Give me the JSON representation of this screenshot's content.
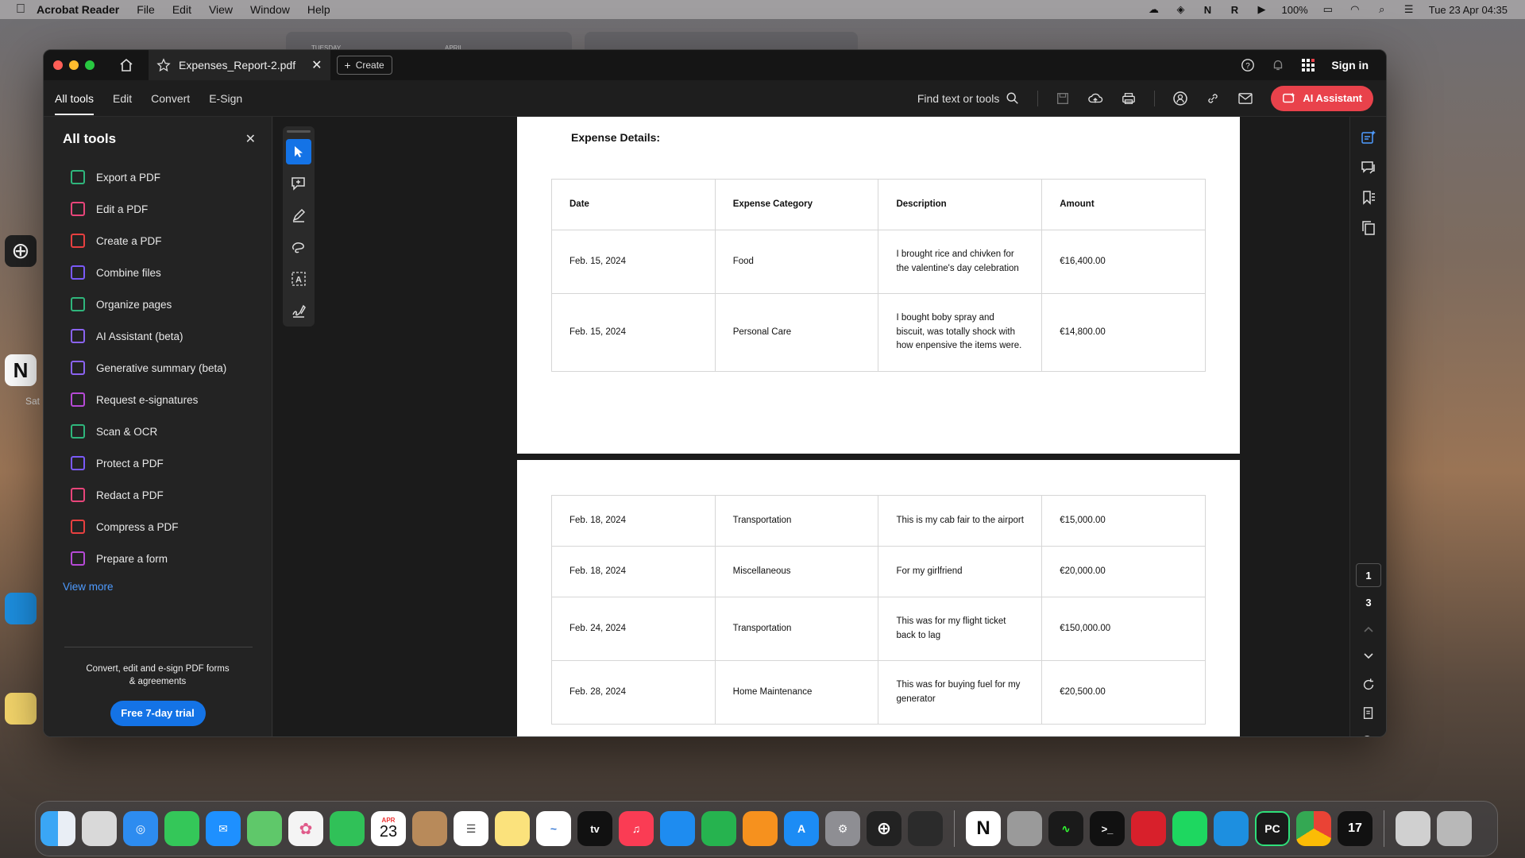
{
  "menubar": {
    "app_name": "Acrobat Reader",
    "menus": [
      "File",
      "Edit",
      "View",
      "Window",
      "Help"
    ],
    "battery": "100%",
    "datetime": "Tue 23 Apr  04:35"
  },
  "window": {
    "tab_title": "Expenses_Report-2.pdf",
    "create_label": "Create",
    "sign_in": "Sign in"
  },
  "toolbar": {
    "tabs": [
      "All tools",
      "Edit",
      "Convert",
      "E-Sign"
    ],
    "find_label": "Find text or tools",
    "ai_assistant": "AI Assistant"
  },
  "left_panel": {
    "title": "All tools",
    "tools": [
      {
        "label": "Export a PDF",
        "color": "#2fb67c"
      },
      {
        "label": "Edit a PDF",
        "color": "#e8457a"
      },
      {
        "label": "Create a PDF",
        "color": "#e84040"
      },
      {
        "label": "Combine files",
        "color": "#7a5af8"
      },
      {
        "label": "Organize pages",
        "color": "#2fb67c"
      },
      {
        "label": "AI Assistant (beta)",
        "color": "#8a63f0"
      },
      {
        "label": "Generative summary (beta)",
        "color": "#8a63f0"
      },
      {
        "label": "Request e-signatures",
        "color": "#b64ad6"
      },
      {
        "label": "Scan & OCR",
        "color": "#2fb67c"
      },
      {
        "label": "Protect a PDF",
        "color": "#7a5af8"
      },
      {
        "label": "Redact a PDF",
        "color": "#e8457a"
      },
      {
        "label": "Compress a PDF",
        "color": "#e84040"
      },
      {
        "label": "Prepare a form",
        "color": "#b64ad6"
      }
    ],
    "view_more": "View more",
    "promo_line1": "Convert, edit and e-sign PDF forms",
    "promo_line2": "& agreements",
    "trial_button": "Free 7-day trial"
  },
  "document": {
    "section_title": "Expense Details:",
    "headers": [
      "Date",
      "Expense Category",
      "Description",
      "Amount"
    ],
    "page1_rows": [
      {
        "date": "Feb. 15, 2024",
        "category": "Food",
        "description": "I brought rice and chivken for the valentine's day celebration",
        "amount": "€16,400.00"
      },
      {
        "date": "Feb. 15, 2024",
        "category": "Personal Care",
        "description": "I bought boby spray and biscuit, was totally shock with how enpensive the items were.",
        "amount": "€14,800.00"
      }
    ],
    "page2_rows": [
      {
        "date": "Feb. 18, 2024",
        "category": "Transportation",
        "description": "This is my cab fair to the airport",
        "amount": "€15,000.00"
      },
      {
        "date": "Feb. 18, 2024",
        "category": "Miscellaneous",
        "description": "For my girlfriend",
        "amount": "€20,000.00"
      },
      {
        "date": "Feb. 24, 2024",
        "category": "Transportation",
        "description": "This was for my flight ticket back to lag",
        "amount": "€150,000.00"
      },
      {
        "date": "Feb. 28, 2024",
        "category": "Home Maintenance",
        "description": "This was for buying fuel for my generator",
        "amount": "€20,500.00"
      }
    ]
  },
  "page_nav": {
    "current": "1",
    "total": "3"
  },
  "dock": {
    "calendar_month": "APR",
    "calendar_day": "23"
  },
  "desktop": {
    "ghost_tab_day": "TUESDAY",
    "ghost_tab_month": "APRIL",
    "side_label": "Sat"
  }
}
